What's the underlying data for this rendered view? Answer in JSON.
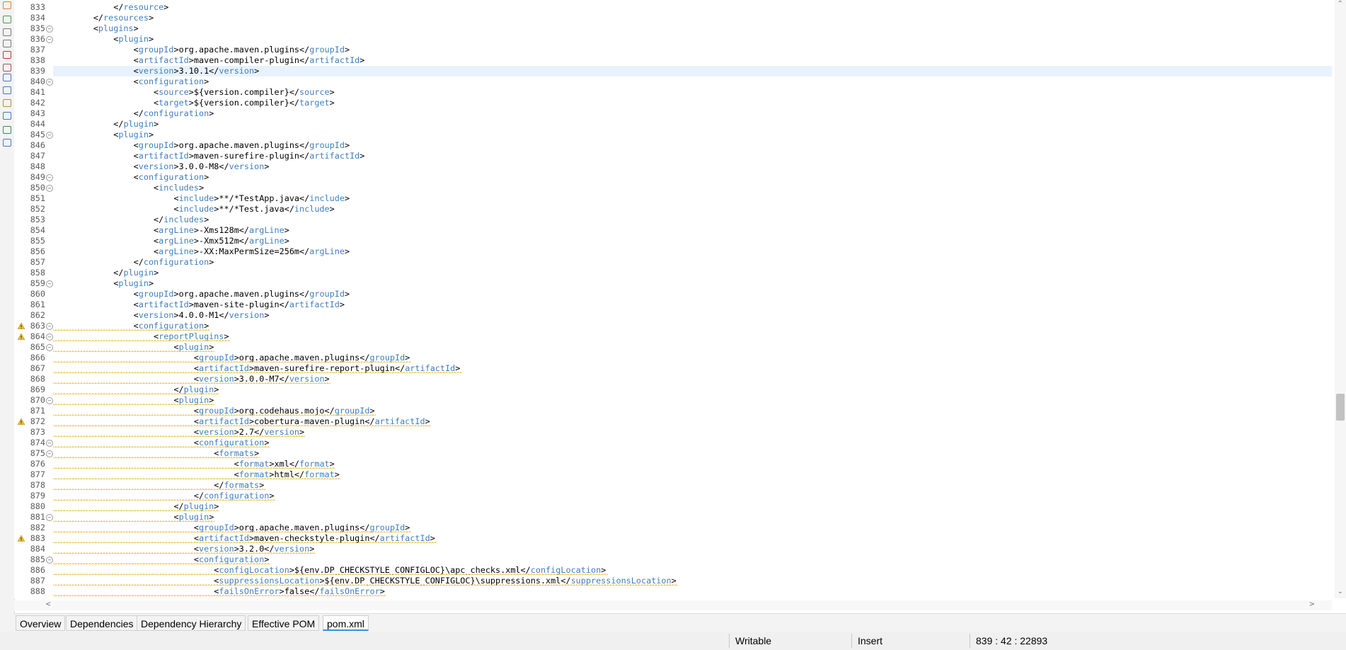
{
  "editor": {
    "current_line": 839,
    "lines": [
      {
        "n": 833,
        "t": "            </resource>"
      },
      {
        "n": 834,
        "t": "        </resources>"
      },
      {
        "n": 835,
        "t": "        <plugins>",
        "fold": true
      },
      {
        "n": 836,
        "t": "            <plugin>",
        "fold": true
      },
      {
        "n": 837,
        "t": "                <groupId>org.apache.maven.plugins</groupId>"
      },
      {
        "n": 838,
        "t": "                <artifactId>maven-compiler-plugin</artifactId>"
      },
      {
        "n": 839,
        "t": "                <version>3.10.1</version>"
      },
      {
        "n": 840,
        "t": "                <configuration>",
        "fold": true
      },
      {
        "n": 841,
        "t": "                    <source>${version.compiler}</source>"
      },
      {
        "n": 842,
        "t": "                    <target>${version.compiler}</target>"
      },
      {
        "n": 843,
        "t": "                </configuration>"
      },
      {
        "n": 844,
        "t": "            </plugin>"
      },
      {
        "n": 845,
        "t": "            <plugin>",
        "fold": true
      },
      {
        "n": 846,
        "t": "                <groupId>org.apache.maven.plugins</groupId>"
      },
      {
        "n": 847,
        "t": "                <artifactId>maven-surefire-plugin</artifactId>"
      },
      {
        "n": 848,
        "t": "                <version>3.0.0-M8</version>"
      },
      {
        "n": 849,
        "t": "                <configuration>",
        "fold": true
      },
      {
        "n": 850,
        "t": "                    <includes>",
        "fold": true
      },
      {
        "n": 851,
        "t": "                        <include>**/*TestApp.java</include>"
      },
      {
        "n": 852,
        "t": "                        <include>**/*Test.java</include>"
      },
      {
        "n": 853,
        "t": "                    </includes>"
      },
      {
        "n": 854,
        "t": "                    <argLine>-Xms128m</argLine>"
      },
      {
        "n": 855,
        "t": "                    <argLine>-Xmx512m</argLine>"
      },
      {
        "n": 856,
        "t": "                    <argLine>-XX:MaxPermSize=256m</argLine>"
      },
      {
        "n": 857,
        "t": "                </configuration>"
      },
      {
        "n": 858,
        "t": "            </plugin>"
      },
      {
        "n": 859,
        "t": "            <plugin>",
        "fold": true
      },
      {
        "n": 860,
        "t": "                <groupId>org.apache.maven.plugins</groupId>"
      },
      {
        "n": 861,
        "t": "                <artifactId>maven-site-plugin</artifactId>"
      },
      {
        "n": 862,
        "t": "                <version>4.0.0-M1</version>"
      },
      {
        "n": 863,
        "t": "                <configuration>",
        "fold": true,
        "warn": true,
        "sq": true
      },
      {
        "n": 864,
        "t": "                    <reportPlugins>",
        "fold": true,
        "warn": true,
        "sq": true
      },
      {
        "n": 865,
        "t": "                        <plugin>",
        "fold": true,
        "sq": true
      },
      {
        "n": 866,
        "t": "                            <groupId>org.apache.maven.plugins</groupId>",
        "sq": true
      },
      {
        "n": 867,
        "t": "                            <artifactId>maven-surefire-report-plugin</artifactId>",
        "sq": true
      },
      {
        "n": 868,
        "t": "                            <version>3.0.0-M7</version>",
        "sq": true
      },
      {
        "n": 869,
        "t": "                        </plugin>",
        "sq": true
      },
      {
        "n": 870,
        "t": "                        <plugin>",
        "fold": true,
        "sq": true
      },
      {
        "n": 871,
        "t": "                            <groupId>org.codehaus.mojo</groupId>",
        "sq": true
      },
      {
        "n": 872,
        "t": "                            <artifactId>cobertura-maven-plugin</artifactId>",
        "warn": true,
        "sq": true
      },
      {
        "n": 873,
        "t": "                            <version>2.7</version>",
        "sq": true
      },
      {
        "n": 874,
        "t": "                            <configuration>",
        "fold": true,
        "sq": true
      },
      {
        "n": 875,
        "t": "                                <formats>",
        "fold": true,
        "sq": true
      },
      {
        "n": 876,
        "t": "                                    <format>xml</format>",
        "sq": true
      },
      {
        "n": 877,
        "t": "                                    <format>html</format>",
        "sq": true
      },
      {
        "n": 878,
        "t": "                                </formats>",
        "sq": true
      },
      {
        "n": 879,
        "t": "                            </configuration>",
        "sq": true
      },
      {
        "n": 880,
        "t": "                        </plugin>",
        "sq": true
      },
      {
        "n": 881,
        "t": "                        <plugin>",
        "fold": true,
        "sq": true
      },
      {
        "n": 882,
        "t": "                            <groupId>org.apache.maven.plugins</groupId>",
        "sq": true
      },
      {
        "n": 883,
        "t": "                            <artifactId>maven-checkstyle-plugin</artifactId>",
        "warn": true,
        "sq": true
      },
      {
        "n": 884,
        "t": "                            <version>3.2.0</version>",
        "sq": true
      },
      {
        "n": 885,
        "t": "                            <configuration>",
        "fold": true,
        "sq": true
      },
      {
        "n": 886,
        "t": "                                <configLocation>${env.DP_CHECKSTYLE_CONFIGLOC}\\apc_checks.xml</configLocation>",
        "sq": true
      },
      {
        "n": 887,
        "t": "                                <suppressionsLocation>${env.DP_CHECKSTYLE_CONFIGLOC}\\suppressions.xml</suppressionsLocation>",
        "sq": true
      },
      {
        "n": 888,
        "t": "                                <failsOnError>false</failsOnError>",
        "sq": true
      }
    ]
  },
  "tabs": [
    {
      "label": "Overview",
      "active": false
    },
    {
      "label": "Dependencies",
      "active": false
    },
    {
      "label": "Dependency Hierarchy",
      "active": false
    },
    {
      "label": "Effective POM",
      "active": false
    },
    {
      "label": "pom.xml",
      "active": true
    }
  ],
  "status": {
    "writable": "Writable",
    "insert_mode": "Insert",
    "position": "839 : 42 : 22893"
  },
  "sidebar_icons": [
    "hierarchy-icon",
    "tree-icon",
    "dotted-grid-icon",
    "list-icon",
    "error-log-icon",
    "stack-icon",
    "at-icon",
    "search-icon",
    "wrench-icon",
    "console-icon",
    "progress-icon",
    "settings-icon"
  ],
  "colors": {
    "tag": "#3f7fbf",
    "text": "#000000",
    "current_line": "#e8f2fe",
    "warning": "#e8b830",
    "tab_accent": "#3b8fd6"
  }
}
